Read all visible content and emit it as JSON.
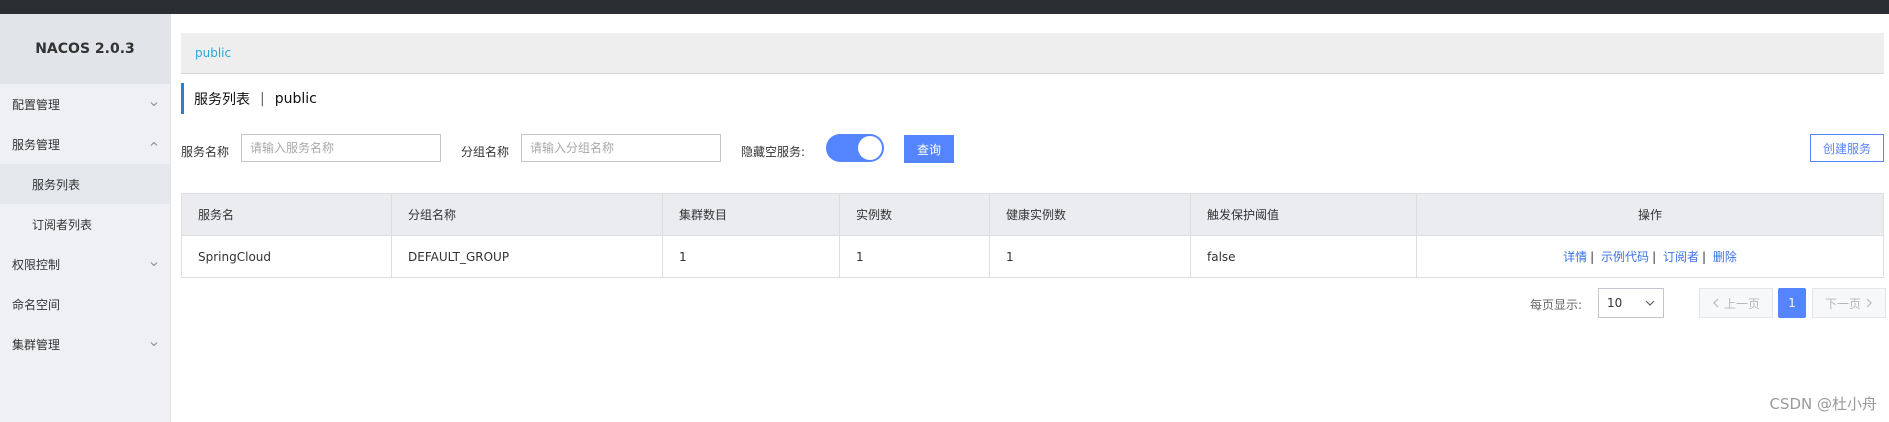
{
  "app": {
    "title": "NACOS 2.0.3"
  },
  "sidebar": {
    "items": [
      {
        "label": "配置管理"
      },
      {
        "label": "服务管理"
      },
      {
        "label": "服务列表"
      },
      {
        "label": "订阅者列表"
      },
      {
        "label": "权限控制"
      },
      {
        "label": "命名空间"
      },
      {
        "label": "集群管理"
      }
    ]
  },
  "breadcrumb": {
    "namespace": "public"
  },
  "page": {
    "title": "服务列表",
    "separator": "|",
    "namespace": "public"
  },
  "filters": {
    "service_name_label": "服务名称",
    "service_name_placeholder": "请输入服务名称",
    "group_name_label": "分组名称",
    "group_name_placeholder": "请输入分组名称",
    "hide_empty_label": "隐藏空服务:",
    "hide_empty_on": true,
    "query_label": "查询",
    "create_label": "创建服务"
  },
  "table": {
    "headers": [
      "服务名",
      "分组名称",
      "集群数目",
      "实例数",
      "健康实例数",
      "触发保护阈值",
      "操作"
    ],
    "rows": [
      {
        "name": "SpringCloud",
        "group": "DEFAULT_GROUP",
        "clusters": "1",
        "instances": "1",
        "healthy": "1",
        "threshold": "false",
        "actions": [
          "详情",
          "示例代码",
          "订阅者",
          "删除"
        ]
      }
    ]
  },
  "pagination": {
    "page_size_label": "每页显示:",
    "page_size": "10",
    "prev_label": "上一页",
    "current_page": "1",
    "next_label": "下一页"
  },
  "watermark": "CSDN @杜小舟",
  "colors": {
    "accent": "#5584ff",
    "link": "#3b72e6",
    "breadcrumb": "#2aa7d9",
    "topbar": "#2b2f33"
  }
}
